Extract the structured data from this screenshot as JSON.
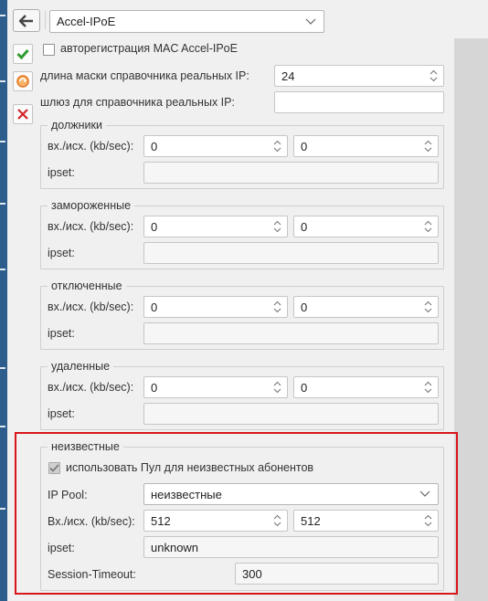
{
  "header": {
    "module_select": "Accel-IPoE"
  },
  "toolbar": {
    "back_icon": "arrow-left-icon",
    "save_icon": "checkmark-icon",
    "refresh_icon": "refresh-icon",
    "delete_icon": "delete-x-icon"
  },
  "form": {
    "autoreg_label": "авторегистрация MAC Accel-IPoE",
    "autoreg_checked": false,
    "mask_label": "длина маски справочника реальных IP:",
    "mask_value": "24",
    "gateway_label": "шлюз для справочника реальных IP:",
    "gateway_value": ""
  },
  "labels": {
    "rate": "вх./исх. (kb/sec):",
    "ipset": "ipset:"
  },
  "groups": [
    {
      "title": "должники",
      "rate_in": "0",
      "rate_out": "0",
      "ipset": ""
    },
    {
      "title": "замороженные",
      "rate_in": "0",
      "rate_out": "0",
      "ipset": ""
    },
    {
      "title": "отключенные",
      "rate_in": "0",
      "rate_out": "0",
      "ipset": ""
    },
    {
      "title": "удаленные",
      "rate_in": "0",
      "rate_out": "0",
      "ipset": ""
    }
  ],
  "unknown": {
    "title": "неизвестные",
    "use_pool_label": "использовать Пул для неизвестных абонентов",
    "use_pool_checked": true,
    "pool_label": "IP Pool:",
    "pool_value": "неизвестные",
    "rate_label": "Вх./исх. (kb/sec):",
    "rate_in": "512",
    "rate_out": "512",
    "ipset_label": "ipset:",
    "ipset_value": "unknown",
    "timeout_label": "Session-Timeout:",
    "timeout_value": "300"
  },
  "colors": {
    "highlight": "#d9161c",
    "save_green": "#2f9a2f",
    "delete_red": "#d2262b",
    "refresh_orange": "#e2731c"
  }
}
